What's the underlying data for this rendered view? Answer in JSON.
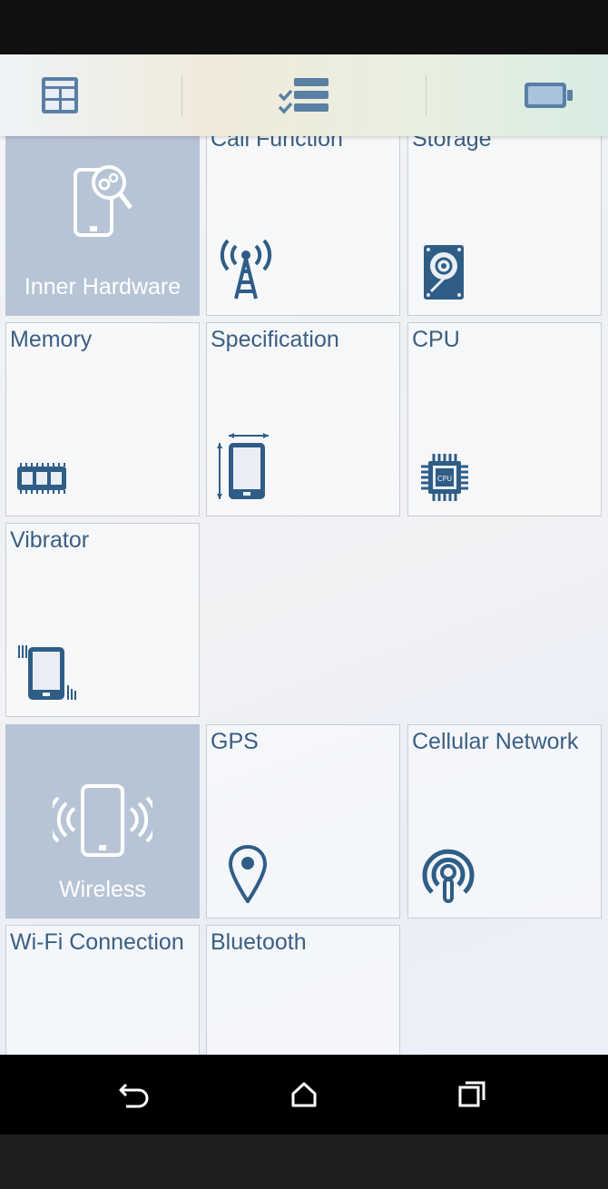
{
  "toolbar": {
    "items": [
      "dashboard-icon",
      "checklist-icon",
      "battery-icon"
    ]
  },
  "tiles": {
    "inner_hardware": "Inner Hardware",
    "call_function": "Call Function",
    "storage": "Storage",
    "memory": "Memory",
    "specification": "Specification",
    "cpu": "CPU",
    "cpu_chip_text": "CPU",
    "vibrator": "Vibrator",
    "wireless": "Wireless",
    "gps": "GPS",
    "cellular_network": "Cellular Network",
    "wifi_connection": "Wi-Fi Connection",
    "bluetooth": "Bluetooth"
  },
  "colors": {
    "accent": "#3b5f83",
    "category_tile": "#b7c4d5"
  },
  "navbar": {
    "items": [
      "back-icon",
      "home-icon",
      "recents-icon"
    ]
  }
}
